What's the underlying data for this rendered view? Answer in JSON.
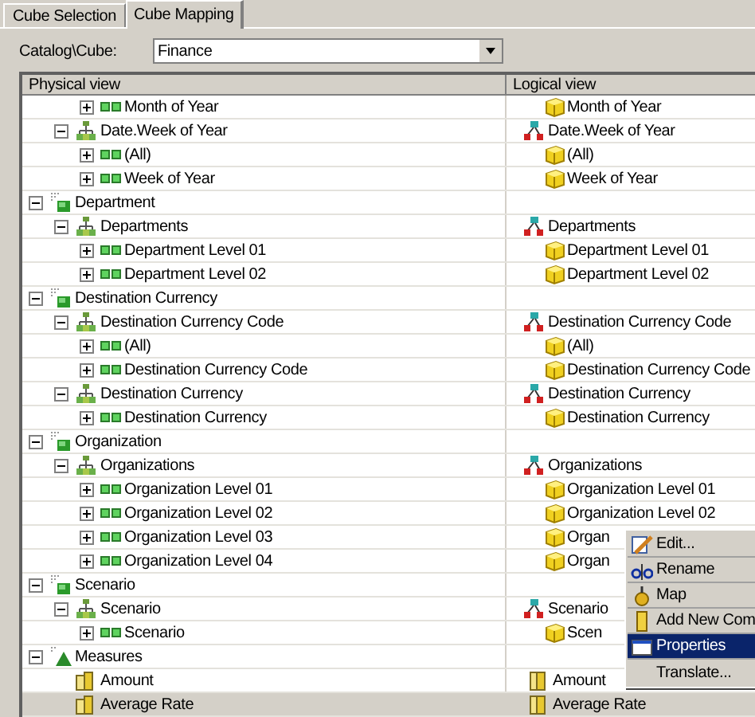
{
  "tabs": [
    {
      "label": "Cube Selection",
      "selected": false
    },
    {
      "label": "Cube Mapping",
      "selected": true
    }
  ],
  "catalog": {
    "label": "Catalog\\Cube:",
    "value": "Finance"
  },
  "tree": {
    "columns": [
      "Physical view",
      "Logical view"
    ],
    "rows": [
      {
        "kind": "offscreen",
        "children": [
          {
            "kind": "offscreen",
            "children": [
              {
                "kind": "level",
                "label": "Month of Year",
                "expanded": false,
                "selected": false,
                "logical": {
                  "kind": "level",
                  "label": "Month of Year"
                }
              }
            ]
          },
          {
            "kind": "hierarchy",
            "label": "Date.Week of Year",
            "expanded": true,
            "selected": false,
            "logical": {
              "kind": "hierarchy",
              "label": "Date.Week of Year"
            },
            "children": [
              {
                "kind": "level",
                "label": "(All)",
                "expanded": false,
                "selected": false,
                "logical": {
                  "kind": "level",
                  "label": "(All)"
                }
              },
              {
                "kind": "level",
                "label": "Week of Year",
                "expanded": false,
                "selected": false,
                "logical": {
                  "kind": "level",
                  "label": "Week of Year"
                }
              }
            ]
          }
        ]
      },
      {
        "kind": "dimension",
        "label": "Department",
        "expanded": true,
        "selected": false,
        "children": [
          {
            "kind": "hierarchy",
            "label": "Departments",
            "expanded": true,
            "selected": false,
            "logical": {
              "kind": "hierarchy",
              "label": "Departments"
            },
            "children": [
              {
                "kind": "level",
                "label": "Department Level 01",
                "expanded": false,
                "selected": false,
                "logical": {
                  "kind": "level",
                  "label": "Department Level 01"
                }
              },
              {
                "kind": "level",
                "label": "Department Level 02",
                "expanded": false,
                "selected": false,
                "logical": {
                  "kind": "level",
                  "label": "Department Level 02"
                }
              }
            ]
          }
        ]
      },
      {
        "kind": "dimension",
        "label": "Destination Currency",
        "expanded": true,
        "selected": false,
        "children": [
          {
            "kind": "hierarchy",
            "label": "Destination Currency Code",
            "expanded": true,
            "selected": false,
            "logical": {
              "kind": "hierarchy",
              "label": "Destination Currency Code"
            },
            "children": [
              {
                "kind": "level",
                "label": "(All)",
                "expanded": false,
                "selected": false,
                "logical": {
                  "kind": "level",
                  "label": "(All)"
                }
              },
              {
                "kind": "level",
                "label": "Destination Currency Code",
                "expanded": false,
                "selected": false,
                "logical": {
                  "kind": "level",
                  "label": "Destination Currency Code"
                }
              }
            ]
          },
          {
            "kind": "hierarchy",
            "label": "Destination Currency",
            "expanded": true,
            "selected": false,
            "logical": {
              "kind": "hierarchy",
              "label": "Destination Currency"
            },
            "children": [
              {
                "kind": "level",
                "label": "Destination Currency",
                "expanded": false,
                "selected": false,
                "logical": {
                  "kind": "level",
                  "label": "Destination Currency"
                }
              }
            ]
          }
        ]
      },
      {
        "kind": "dimension",
        "label": "Organization",
        "expanded": true,
        "selected": false,
        "children": [
          {
            "kind": "hierarchy",
            "label": "Organizations",
            "expanded": true,
            "selected": false,
            "logical": {
              "kind": "hierarchy",
              "label": "Organizations"
            },
            "children": [
              {
                "kind": "level",
                "label": "Organization Level 01",
                "expanded": false,
                "selected": false,
                "logical": {
                  "kind": "level",
                  "label": "Organization Level 01"
                }
              },
              {
                "kind": "level",
                "label": "Organization Level 02",
                "expanded": false,
                "selected": false,
                "logical": {
                  "kind": "level",
                  "label": "Organization Level 02"
                }
              },
              {
                "kind": "level",
                "label": "Organization Level 03",
                "expanded": false,
                "selected": false,
                "logical": {
                  "kind": "level",
                  "label": "Organ"
                }
              },
              {
                "kind": "level",
                "label": "Organization Level 04",
                "expanded": false,
                "selected": false,
                "logical": {
                  "kind": "level",
                  "label": "Organ"
                }
              }
            ]
          }
        ]
      },
      {
        "kind": "dimension",
        "label": "Scenario",
        "expanded": true,
        "selected": false,
        "children": [
          {
            "kind": "hierarchy",
            "label": "Scenario",
            "expanded": true,
            "selected": false,
            "logical": {
              "kind": "hierarchy",
              "label": "Scenario"
            },
            "children": [
              {
                "kind": "level",
                "label": "Scenario",
                "expanded": false,
                "selected": false,
                "logical": {
                  "kind": "level",
                  "label": "Scen"
                }
              }
            ]
          }
        ]
      },
      {
        "kind": "measures",
        "label": "Measures",
        "expanded": true,
        "selected": false,
        "children": [
          {
            "kind": "measure",
            "label": "Amount",
            "selected": false,
            "logical": {
              "kind": "measure",
              "label": "Amount"
            }
          },
          {
            "kind": "measure",
            "label": "Average Rate",
            "selected": true,
            "logical": {
              "kind": "measure",
              "label": "Average Rate"
            }
          }
        ]
      }
    ]
  },
  "context_menu": {
    "items": [
      {
        "kind": "edit",
        "label": "Edit...",
        "selected": false
      },
      {
        "kind": "rename",
        "label": "Rename",
        "selected": false
      },
      {
        "kind": "map",
        "label": "Map",
        "selected": false
      },
      {
        "kind": "add",
        "label": "Add New Com",
        "selected": false
      },
      {
        "kind": "properties",
        "label": "Properties",
        "selected": true
      },
      {
        "kind": "plain",
        "label": "Translate...",
        "selected": false
      }
    ]
  }
}
